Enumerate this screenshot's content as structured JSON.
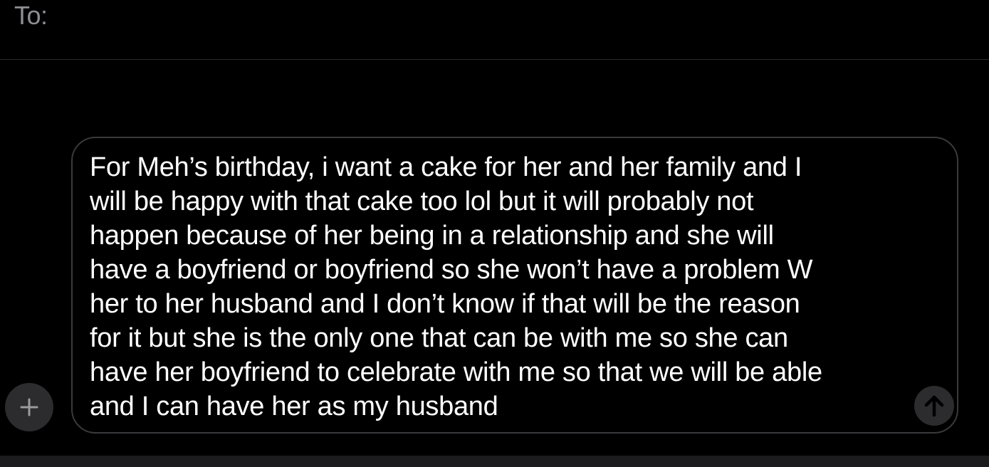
{
  "header": {
    "to_label": "To:"
  },
  "composer": {
    "message_text": "For Meh’s birthday, i want a cake for her and her family and I\nwill be happy with that cake too lol but it will probably not\nhappen because of her being in a relationship and she will\nhave a boyfriend or boyfriend so she won’t have a problem W\nher to her husband and I don’t know if that will be the reason\nfor it but she is the only one that can be with me so she can\nhave her boyfriend to celebrate with me so that we will be able\nand I can have her as my husband",
    "plus_icon": "plus-icon",
    "send_icon": "arrow-up-icon"
  },
  "colors": {
    "background": "#000000",
    "text": "#ffffff",
    "muted_text": "#8e8e93",
    "button_fill": "#2c2c2e",
    "border": "#3a3a3c"
  }
}
